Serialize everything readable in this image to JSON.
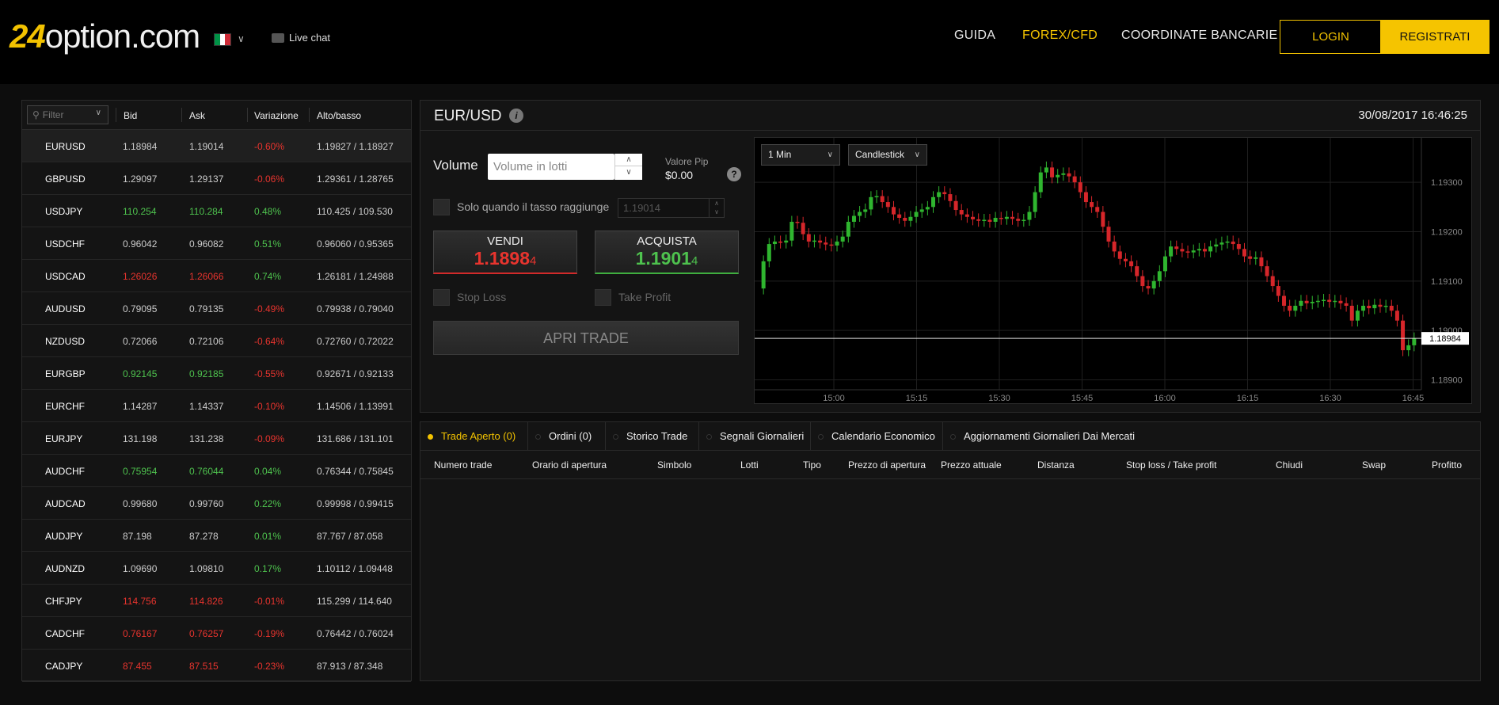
{
  "header": {
    "logo_num": "24",
    "logo_text": "option.com",
    "flag": "italy-flag",
    "livechat": "Live chat",
    "nav": [
      "GUIDA",
      "FOREX/CFD",
      "COORDINATE BANCARIE"
    ],
    "login": "LOGIN",
    "register": "REGISTRATI",
    "colors": {
      "accent": "#f2c200",
      "red": "#e8342e",
      "green": "#4ec24e"
    }
  },
  "instruments": {
    "filter_placeholder": "Filter",
    "columns": [
      "Bid",
      "Ask",
      "Variazione",
      "Alto/basso"
    ],
    "rows": [
      {
        "symbol": "EURUSD",
        "bid": "1.18984",
        "ask": "1.19014",
        "change": "-0.60%",
        "hl": "1.19827 / 1.18927",
        "pc": "white",
        "cc": "red"
      },
      {
        "symbol": "GBPUSD",
        "bid": "1.29097",
        "ask": "1.29137",
        "change": "-0.06%",
        "hl": "1.29361 / 1.28765",
        "pc": "white",
        "cc": "red"
      },
      {
        "symbol": "USDJPY",
        "bid": "110.254",
        "ask": "110.284",
        "change": "0.48%",
        "hl": "110.425 / 109.530",
        "pc": "green",
        "cc": "green"
      },
      {
        "symbol": "USDCHF",
        "bid": "0.96042",
        "ask": "0.96082",
        "change": "0.51%",
        "hl": "0.96060 / 0.95365",
        "pc": "white",
        "cc": "green"
      },
      {
        "symbol": "USDCAD",
        "bid": "1.26026",
        "ask": "1.26066",
        "change": "0.74%",
        "hl": "1.26181 / 1.24988",
        "pc": "red",
        "cc": "green"
      },
      {
        "symbol": "AUDUSD",
        "bid": "0.79095",
        "ask": "0.79135",
        "change": "-0.49%",
        "hl": "0.79938 / 0.79040",
        "pc": "white",
        "cc": "red"
      },
      {
        "symbol": "NZDUSD",
        "bid": "0.72066",
        "ask": "0.72106",
        "change": "-0.64%",
        "hl": "0.72760 / 0.72022",
        "pc": "white",
        "cc": "red"
      },
      {
        "symbol": "EURGBP",
        "bid": "0.92145",
        "ask": "0.92185",
        "change": "-0.55%",
        "hl": "0.92671 / 0.92133",
        "pc": "green",
        "cc": "red"
      },
      {
        "symbol": "EURCHF",
        "bid": "1.14287",
        "ask": "1.14337",
        "change": "-0.10%",
        "hl": "1.14506 / 1.13991",
        "pc": "white",
        "cc": "red"
      },
      {
        "symbol": "EURJPY",
        "bid": "131.198",
        "ask": "131.238",
        "change": "-0.09%",
        "hl": "131.686 / 131.101",
        "pc": "white",
        "cc": "red"
      },
      {
        "symbol": "AUDCHF",
        "bid": "0.75954",
        "ask": "0.76044",
        "change": "0.04%",
        "hl": "0.76344 / 0.75845",
        "pc": "green",
        "cc": "green"
      },
      {
        "symbol": "AUDCAD",
        "bid": "0.99680",
        "ask": "0.99760",
        "change": "0.22%",
        "hl": "0.99998 / 0.99415",
        "pc": "white",
        "cc": "green"
      },
      {
        "symbol": "AUDJPY",
        "bid": "87.198",
        "ask": "87.278",
        "change": "0.01%",
        "hl": "87.767 / 87.058",
        "pc": "white",
        "cc": "green"
      },
      {
        "symbol": "AUDNZD",
        "bid": "1.09690",
        "ask": "1.09810",
        "change": "0.17%",
        "hl": "1.10112 / 1.09448",
        "pc": "white",
        "cc": "green"
      },
      {
        "symbol": "CHFJPY",
        "bid": "114.756",
        "ask": "114.826",
        "change": "-0.01%",
        "hl": "115.299 / 114.640",
        "pc": "red",
        "cc": "red"
      },
      {
        "symbol": "CADCHF",
        "bid": "0.76167",
        "ask": "0.76257",
        "change": "-0.19%",
        "hl": "0.76442 / 0.76024",
        "pc": "red",
        "cc": "red"
      },
      {
        "symbol": "CADJPY",
        "bid": "87.455",
        "ask": "87.515",
        "change": "-0.23%",
        "hl": "87.913 / 87.348",
        "pc": "red",
        "cc": "red"
      }
    ]
  },
  "trade": {
    "pair": "EUR/USD",
    "datetime": "30/08/2017 16:46:25",
    "volume_label": "Volume",
    "volume_placeholder": "Volume in lotti",
    "pip_label": "Valore Pip",
    "pip_value": "$0.00",
    "rate_check_label": "Solo quando il tasso raggiunge",
    "rate_value": "1.19014",
    "sell_label": "VENDI",
    "sell_main": "1.1898",
    "sell_tail": "4",
    "buy_label": "ACQUISTA",
    "buy_main": "1.1901",
    "buy_tail": "4",
    "stop_loss": "Stop Loss",
    "take_profit": "Take Profit",
    "open_trade": "APRI TRADE"
  },
  "chart_data": {
    "type": "candlestick",
    "interval": "1 Min",
    "style": "Candlestick",
    "y_ticks": [
      "1.19300",
      "1.19200",
      "1.19100",
      "1.19000",
      "1.18900"
    ],
    "x_ticks": [
      "15:00",
      "15:15",
      "15:30",
      "15:45",
      "16:00",
      "16:15",
      "16:30",
      "16:45"
    ],
    "ylim": [
      1.1888,
      1.1939
    ],
    "current_price": "1.18984",
    "current_value": 1.18984,
    "series": [
      1.19085,
      1.1914,
      1.19175,
      1.1918,
      1.19178,
      1.19182,
      1.1922,
      1.19218,
      1.19195,
      1.1918,
      1.19182,
      1.19178,
      1.19174,
      1.19172,
      1.1918,
      1.1919,
      1.1922,
      1.19232,
      1.1924,
      1.19245,
      1.1927,
      1.19272,
      1.1926,
      1.1925,
      1.19235,
      1.19228,
      1.19222,
      1.1923,
      1.1924,
      1.19245,
      1.1925,
      1.1927,
      1.1928,
      1.19276,
      1.19262,
      1.19244,
      1.19235,
      1.1923,
      1.19225,
      1.19222,
      1.19224,
      1.1922,
      1.19228,
      1.19226,
      1.1923,
      1.19226,
      1.19222,
      1.19224,
      1.1924,
      1.1928,
      1.1932,
      1.1933,
      1.1931,
      1.19315,
      1.19318,
      1.19312,
      1.193,
      1.1928,
      1.1926,
      1.1925,
      1.1924,
      1.1921,
      1.1918,
      1.1916,
      1.19145,
      1.1914,
      1.1913,
      1.1911,
      1.1909,
      1.19085,
      1.191,
      1.1912,
      1.1915,
      1.1917,
      1.19165,
      1.1916,
      1.19158,
      1.19162,
      1.19165,
      1.1916,
      1.1917,
      1.19174,
      1.19178,
      1.1918,
      1.19175,
      1.19165,
      1.1915,
      1.19145,
      1.19148,
      1.1913,
      1.1911,
      1.1909,
      1.1907,
      1.1905,
      1.1904,
      1.1905,
      1.1906,
      1.19055,
      1.19058,
      1.1906,
      1.19062,
      1.19058,
      1.1906,
      1.19055,
      1.1905,
      1.1902,
      1.1904,
      1.1905,
      1.19045,
      1.19052,
      1.19048,
      1.1905,
      1.1904,
      1.1902,
      1.1896,
      1.1897,
      1.18984
    ]
  },
  "bottom": {
    "tabs": [
      "Trade Aperto (0)",
      "Ordini (0)",
      "Storico Trade",
      "Segnali Giornalieri",
      "Calendario Economico",
      "Aggiornamenti Giornalieri Dai Mercati"
    ],
    "columns": [
      "Numero trade",
      "Orario di apertura",
      "Simbolo",
      "Lotti",
      "Tipo",
      "Prezzo di apertura",
      "Prezzo attuale",
      "Distanza",
      "Stop loss / Take profit",
      "Chiudi",
      "Swap",
      "Profitto"
    ]
  }
}
